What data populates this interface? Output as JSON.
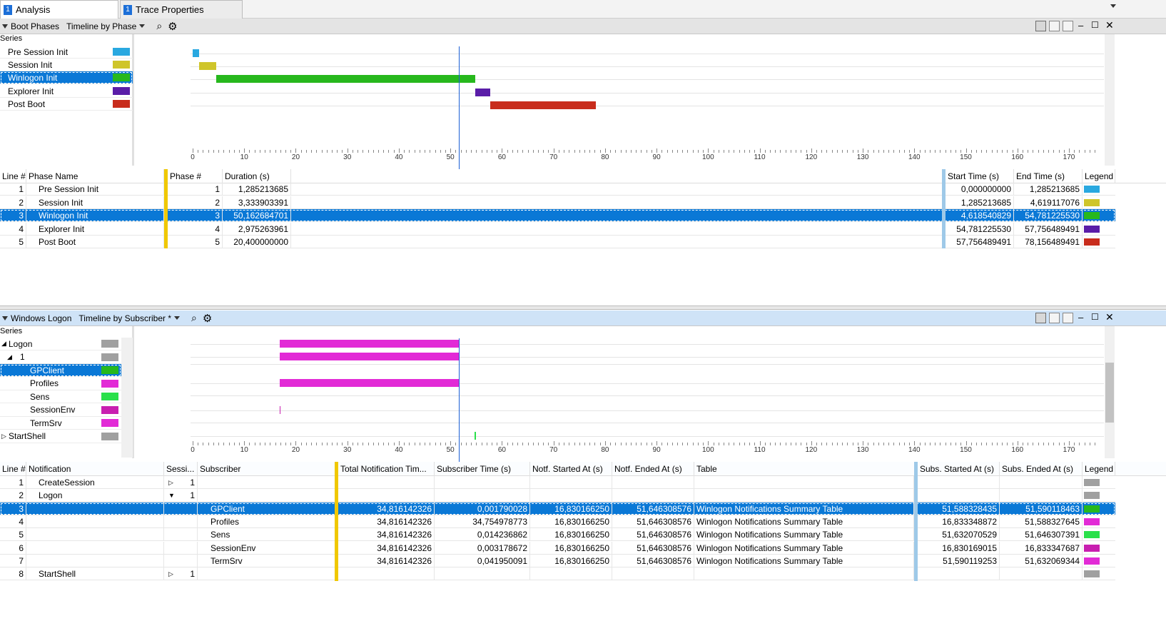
{
  "tabs": [
    {
      "num": "1",
      "label": "Analysis"
    },
    {
      "num": "1",
      "label": "Trace Properties"
    }
  ],
  "colors": {
    "accent": "#0a78d6",
    "pre_session": "#29a8e0",
    "session": "#cfc52a",
    "winlogon": "#27b81d",
    "explorer": "#5a1da8",
    "post_boot": "#c82c1c",
    "magenta": "#e22ad6",
    "sens": "#2ae04a",
    "gray": "#a0a0a0",
    "tracker": "#1b5fd6"
  },
  "top": {
    "title": "Boot Phases",
    "view": "Timeline by Phase",
    "series_header": "Series",
    "series": [
      {
        "label": "Pre Session Init",
        "color": "#29a8e0"
      },
      {
        "label": "Session Init",
        "color": "#cfc52a"
      },
      {
        "label": "Winlogon Init",
        "color": "#27b81d",
        "selected": true
      },
      {
        "label": "Explorer Init",
        "color": "#5a1da8"
      },
      {
        "label": "Post Boot",
        "color": "#c82c1c"
      }
    ],
    "table": {
      "headers": [
        "Line #",
        "Phase Name",
        "Phase #",
        "Duration (s)",
        "Start Time (s)",
        "End Time (s)",
        "Legend"
      ],
      "rows": [
        {
          "line": "1",
          "name": "Pre Session Init",
          "phase": "1",
          "duration": "1,285213685",
          "start": "0,000000000",
          "end": "1,285213685",
          "color": "#29a8e0"
        },
        {
          "line": "2",
          "name": "Session Init",
          "phase": "2",
          "duration": "3,333903391",
          "start": "1,285213685",
          "end": "4,619117076",
          "color": "#cfc52a"
        },
        {
          "line": "3",
          "name": "Winlogon Init",
          "phase": "3",
          "duration": "50,162684701",
          "start": "4,618540829",
          "end": "54,781225530",
          "color": "#27b81d",
          "selected": true
        },
        {
          "line": "4",
          "name": "Explorer Init",
          "phase": "4",
          "duration": "2,975263961",
          "start": "54,781225530",
          "end": "57,756489491",
          "color": "#5a1da8"
        },
        {
          "line": "5",
          "name": "Post Boot",
          "phase": "5",
          "duration": "20,400000000",
          "start": "57,756489491",
          "end": "78,156489491",
          "color": "#c82c1c"
        }
      ]
    }
  },
  "axis_labels": [
    "0",
    "10",
    "20",
    "30",
    "40",
    "50",
    "60",
    "70",
    "80",
    "90",
    "100",
    "110",
    "120",
    "130",
    "140",
    "150",
    "160",
    "170"
  ],
  "bottom": {
    "title": "Windows Logon",
    "view": "Timeline by Subscriber *",
    "series_header": "Series",
    "series": [
      {
        "label": "Logon",
        "indent": 0,
        "expanded": true,
        "color": "#a0a0a0"
      },
      {
        "label": "1",
        "indent": 1,
        "expanded": true,
        "color": "#a0a0a0"
      },
      {
        "label": "GPClient",
        "indent": 2,
        "color": "#27b81d",
        "selected": true
      },
      {
        "label": "Profiles",
        "indent": 2,
        "color": "#e22ad6"
      },
      {
        "label": "Sens",
        "indent": 2,
        "color": "#2ae04a"
      },
      {
        "label": "SessionEnv",
        "indent": 2,
        "color": "#c81fb0"
      },
      {
        "label": "TermSrv",
        "indent": 2,
        "color": "#e22ad6"
      },
      {
        "label": "StartShell",
        "indent": 0,
        "expanded": false,
        "color": "#a0a0a0"
      }
    ],
    "table": {
      "headers": [
        "Line #",
        "Notification",
        "Sessi...",
        "Subscriber",
        "Total Notification Tim...",
        "Subscriber Time (s)",
        "Notf. Started At (s)",
        "Notf. Ended At (s)",
        "Table",
        "Subs. Started At (s)",
        "Subs. Ended At (s)",
        "Legend"
      ],
      "rows": [
        {
          "line": "1",
          "notification": "CreateSession",
          "session": "1",
          "subscriber": "",
          "total": "",
          "subtime": "",
          "nstart": "",
          "nend": "",
          "table": "",
          "sstart": "",
          "send": "",
          "color": "#a0a0a0",
          "expander": "right"
        },
        {
          "line": "2",
          "notification": "Logon",
          "session": "1",
          "subscriber": "",
          "total": "",
          "subtime": "",
          "nstart": "",
          "nend": "",
          "table": "",
          "sstart": "",
          "send": "",
          "color": "#a0a0a0",
          "expander": "down"
        },
        {
          "line": "3",
          "notification": "",
          "session": "",
          "subscriber": "GPClient",
          "total": "34,816142326",
          "subtime": "0,001790028",
          "nstart": "16,830166250",
          "nend": "51,646308576",
          "table": "Winlogon Notifications Summary Table",
          "sstart": "51,588328435",
          "send": "51,590118463",
          "color": "#27b81d",
          "selected": true
        },
        {
          "line": "4",
          "notification": "",
          "session": "",
          "subscriber": "Profiles",
          "total": "34,816142326",
          "subtime": "34,754978773",
          "nstart": "16,830166250",
          "nend": "51,646308576",
          "table": "Winlogon Notifications Summary Table",
          "sstart": "16,833348872",
          "send": "51,588327645",
          "color": "#e22ad6"
        },
        {
          "line": "5",
          "notification": "",
          "session": "",
          "subscriber": "Sens",
          "total": "34,816142326",
          "subtime": "0,014236862",
          "nstart": "16,830166250",
          "nend": "51,646308576",
          "table": "Winlogon Notifications Summary Table",
          "sstart": "51,632070529",
          "send": "51,646307391",
          "color": "#2ae04a"
        },
        {
          "line": "6",
          "notification": "",
          "session": "",
          "subscriber": "SessionEnv",
          "total": "34,816142326",
          "subtime": "0,003178672",
          "nstart": "16,830166250",
          "nend": "51,646308576",
          "table": "Winlogon Notifications Summary Table",
          "sstart": "16,830169015",
          "send": "16,833347687",
          "color": "#c81fb0"
        },
        {
          "line": "7",
          "notification": "",
          "session": "",
          "subscriber": "TermSrv",
          "total": "34,816142326",
          "subtime": "0,041950091",
          "nstart": "16,830166250",
          "nend": "51,646308576",
          "table": "Winlogon Notifications Summary Table",
          "sstart": "51,590119253",
          "send": "51,632069344",
          "color": "#e22ad6"
        },
        {
          "line": "8",
          "notification": "StartShell",
          "session": "1",
          "subscriber": "",
          "total": "",
          "subtime": "",
          "nstart": "",
          "nend": "",
          "table": "",
          "sstart": "",
          "send": "",
          "color": "#a0a0a0",
          "expander": "right"
        }
      ]
    }
  },
  "top_bars": [
    {
      "start": 0,
      "end": 1.285,
      "color": "#29a8e0"
    },
    {
      "start": 1.285,
      "end": 4.619,
      "color": "#cfc52a"
    },
    {
      "start": 4.619,
      "end": 54.781,
      "color": "#27b81d"
    },
    {
      "start": 54.781,
      "end": 57.756,
      "color": "#5a1da8"
    },
    {
      "start": 57.756,
      "end": 78.156,
      "color": "#c82c1c"
    }
  ],
  "bottom_bars": [
    {
      "start": 16.83,
      "end": 51.646,
      "color": "#e22ad6"
    },
    {
      "start": 16.83,
      "end": 51.646,
      "color": "#e22ad6"
    },
    {
      "start": 51.6,
      "end": 51.61,
      "color": "#27b81d"
    },
    {
      "start": 16.83,
      "end": 51.646,
      "color": "#e22ad6"
    },
    {
      "start": 51.63,
      "end": 51.646,
      "color": "#2ae04a"
    },
    {
      "start": 16.83,
      "end": 16.95,
      "color": "#c81fb0"
    },
    {
      "start": 51.59,
      "end": 51.63,
      "color": "#e22ad6"
    },
    {
      "start": 54.7,
      "end": 54.8,
      "color": "#2ae04a"
    }
  ],
  "tracker_time": 51.59
}
